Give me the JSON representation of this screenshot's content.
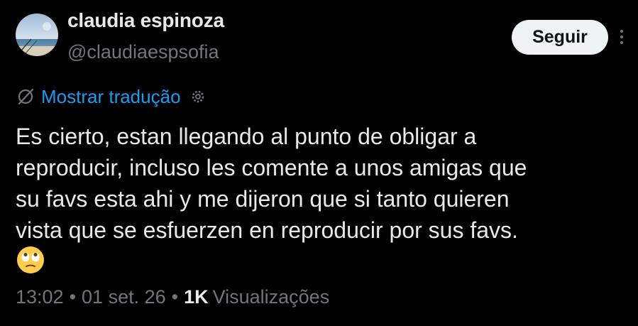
{
  "author": {
    "display_name": "claudia espinoza",
    "handle": "@claudiaespsofia",
    "avatar_icon": "avatar-beach-photo"
  },
  "actions": {
    "follow_label": "Seguir",
    "more_icon": "more-vertical-icon"
  },
  "translation": {
    "icon": "translate-icon",
    "link_label": "Mostrar tradução",
    "settings_icon": "gear-icon"
  },
  "tweet": {
    "text": "Es cierto, estan llegando al punto de obligar a\nreproducir, incluso les comente a unos amigas que\nsu favs esta ahi y me dijeron que si tanto quieren\nvista que se esfuerzen en reproducir por sus favs.",
    "emoji": "🙄"
  },
  "meta": {
    "time": "13:02",
    "date": "01 set. 26",
    "separator": "•",
    "views_count": "1K",
    "views_label": "Visualizações"
  },
  "colors": {
    "background": "#000000",
    "text_primary": "#e7e9ea",
    "text_secondary": "#71767b",
    "link": "#1d9bf0",
    "button_bg": "#eff3f4"
  }
}
